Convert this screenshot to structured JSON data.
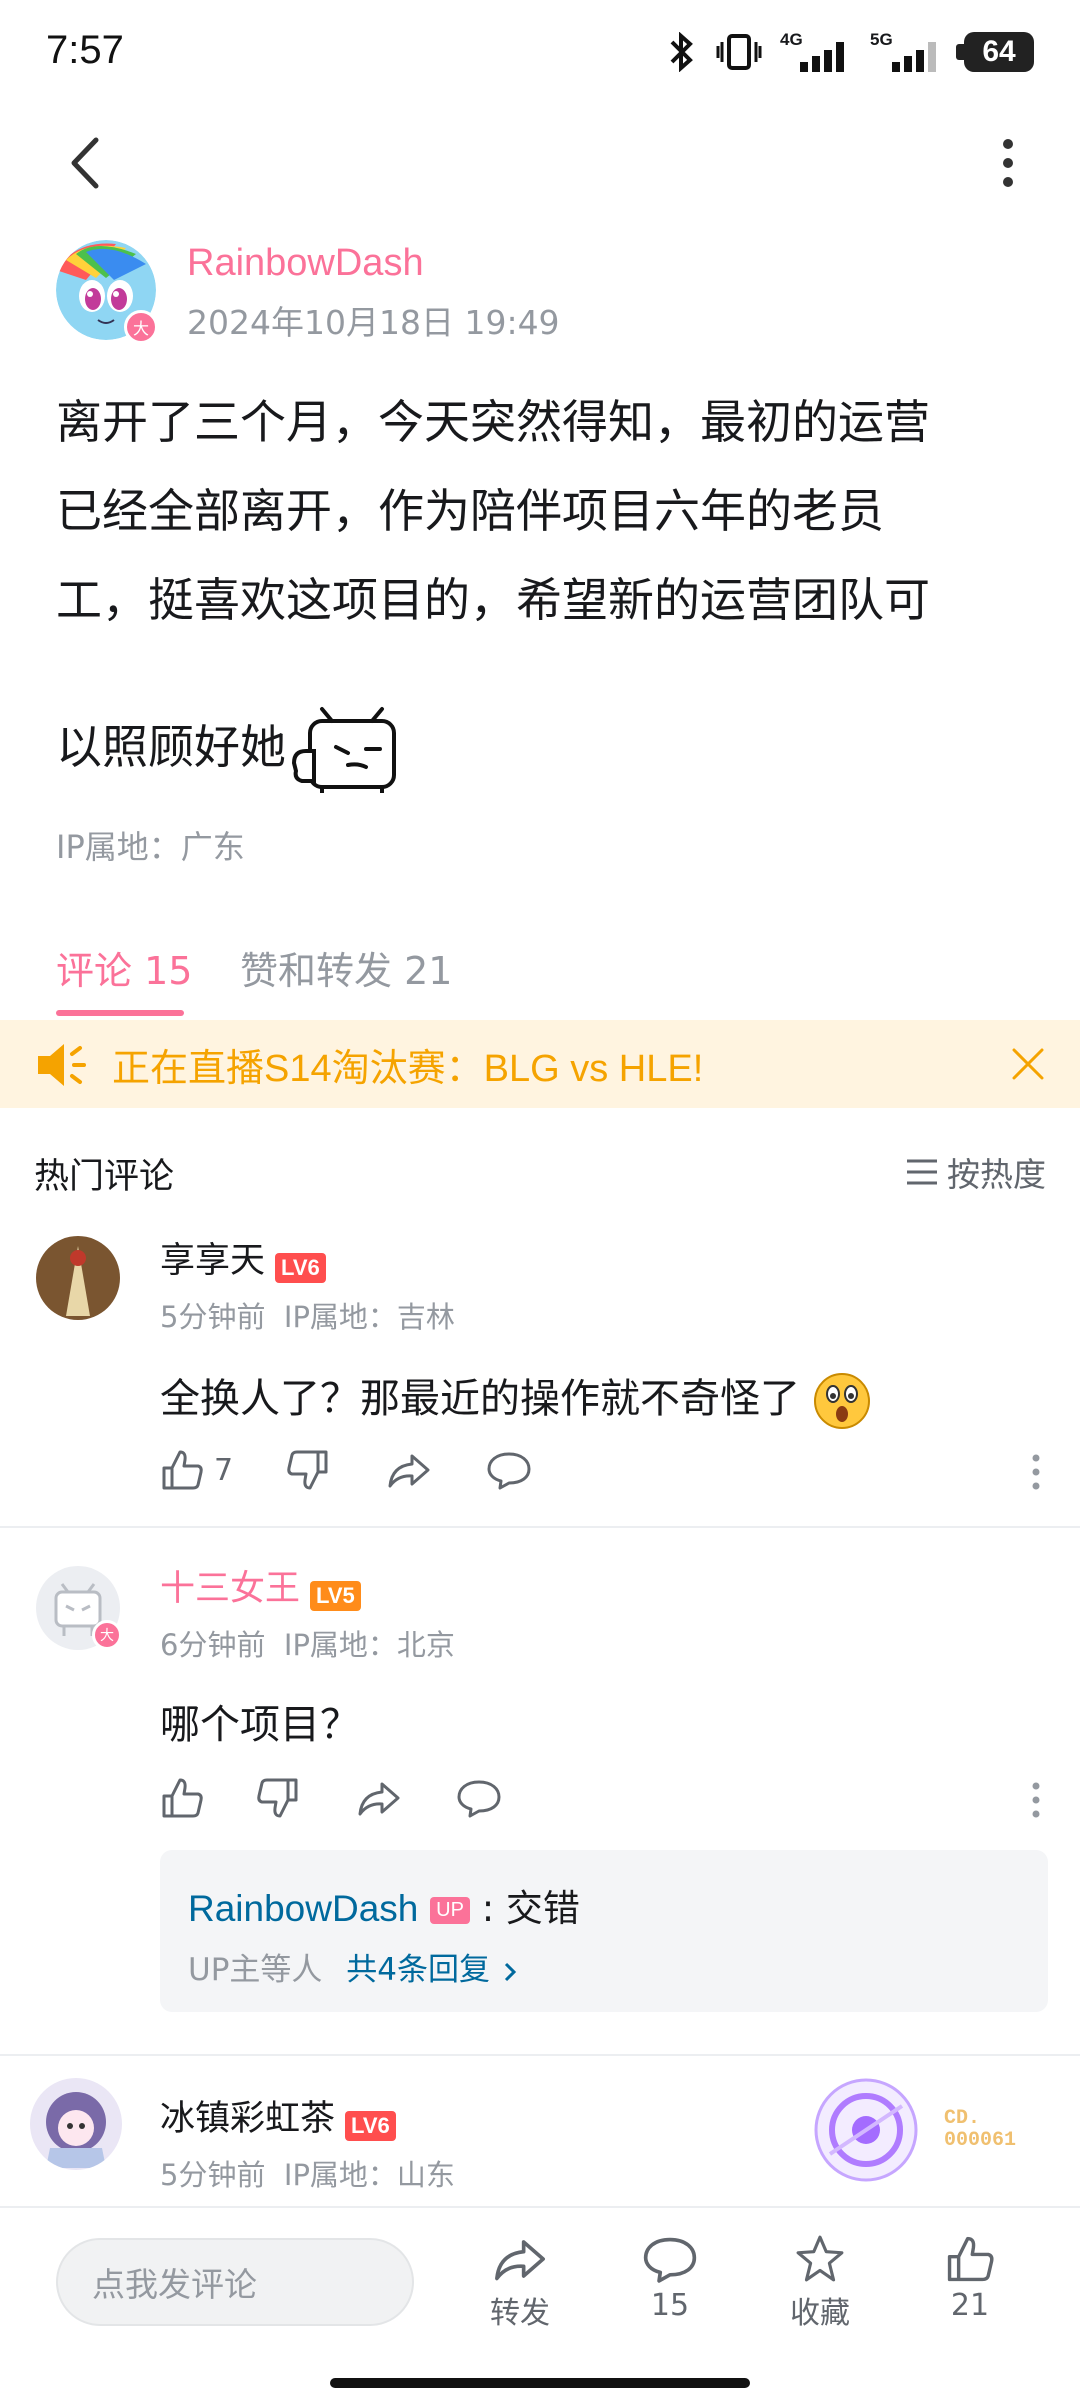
{
  "status": {
    "time": "7:57",
    "network1": "4G",
    "network2": "5G",
    "battery": "64"
  },
  "post": {
    "author": "RainbowDash",
    "date": "2024年10月18日 19:49",
    "avatar_badge": "大",
    "lines": [
      "离开了三个月，今天突然得知，最初的运营",
      "已经全部离开，作为陪伴项目六年的老员",
      "工，挺喜欢这项目的，希望新的运营团队可"
    ],
    "last_line": "以照顾好她",
    "ip": "IP属地：广东"
  },
  "tabs": {
    "comments": "评论 15",
    "likes": "赞和转发 21"
  },
  "banner": {
    "text": "正在直播S14淘汰赛：BLG vs HLE!"
  },
  "comments_header": {
    "title": "热门评论",
    "sort": "按热度"
  },
  "comments": [
    {
      "name": "享享天",
      "level": "LV6",
      "time": "5分钟前",
      "ip": "IP属地：吉林",
      "text": "全换人了？那最近的操作就不奇怪了",
      "likes": "7"
    },
    {
      "name": "十三女王",
      "level": "LV5",
      "time": "6分钟前",
      "ip": "IP属地：北京",
      "text": "哪个项目？",
      "avatar_badge": "大",
      "reply": {
        "name": "RainbowDash",
        "up_tag": "UP",
        "text": ": 交错",
        "summary": "UP主等人",
        "count": "共4条回复"
      }
    },
    {
      "name": "冰镇彩虹茶",
      "level": "LV6",
      "time": "5分钟前",
      "ip": "IP属地：山东",
      "medal": "CD.\n000061"
    }
  ],
  "bottom": {
    "placeholder": "点我发评论",
    "share": "转发",
    "comment_count": "15",
    "fav": "收藏",
    "like_count": "21"
  },
  "colors": {
    "pink": "#fb7299",
    "banner_text": "#f5a300",
    "link": "#00699d"
  }
}
